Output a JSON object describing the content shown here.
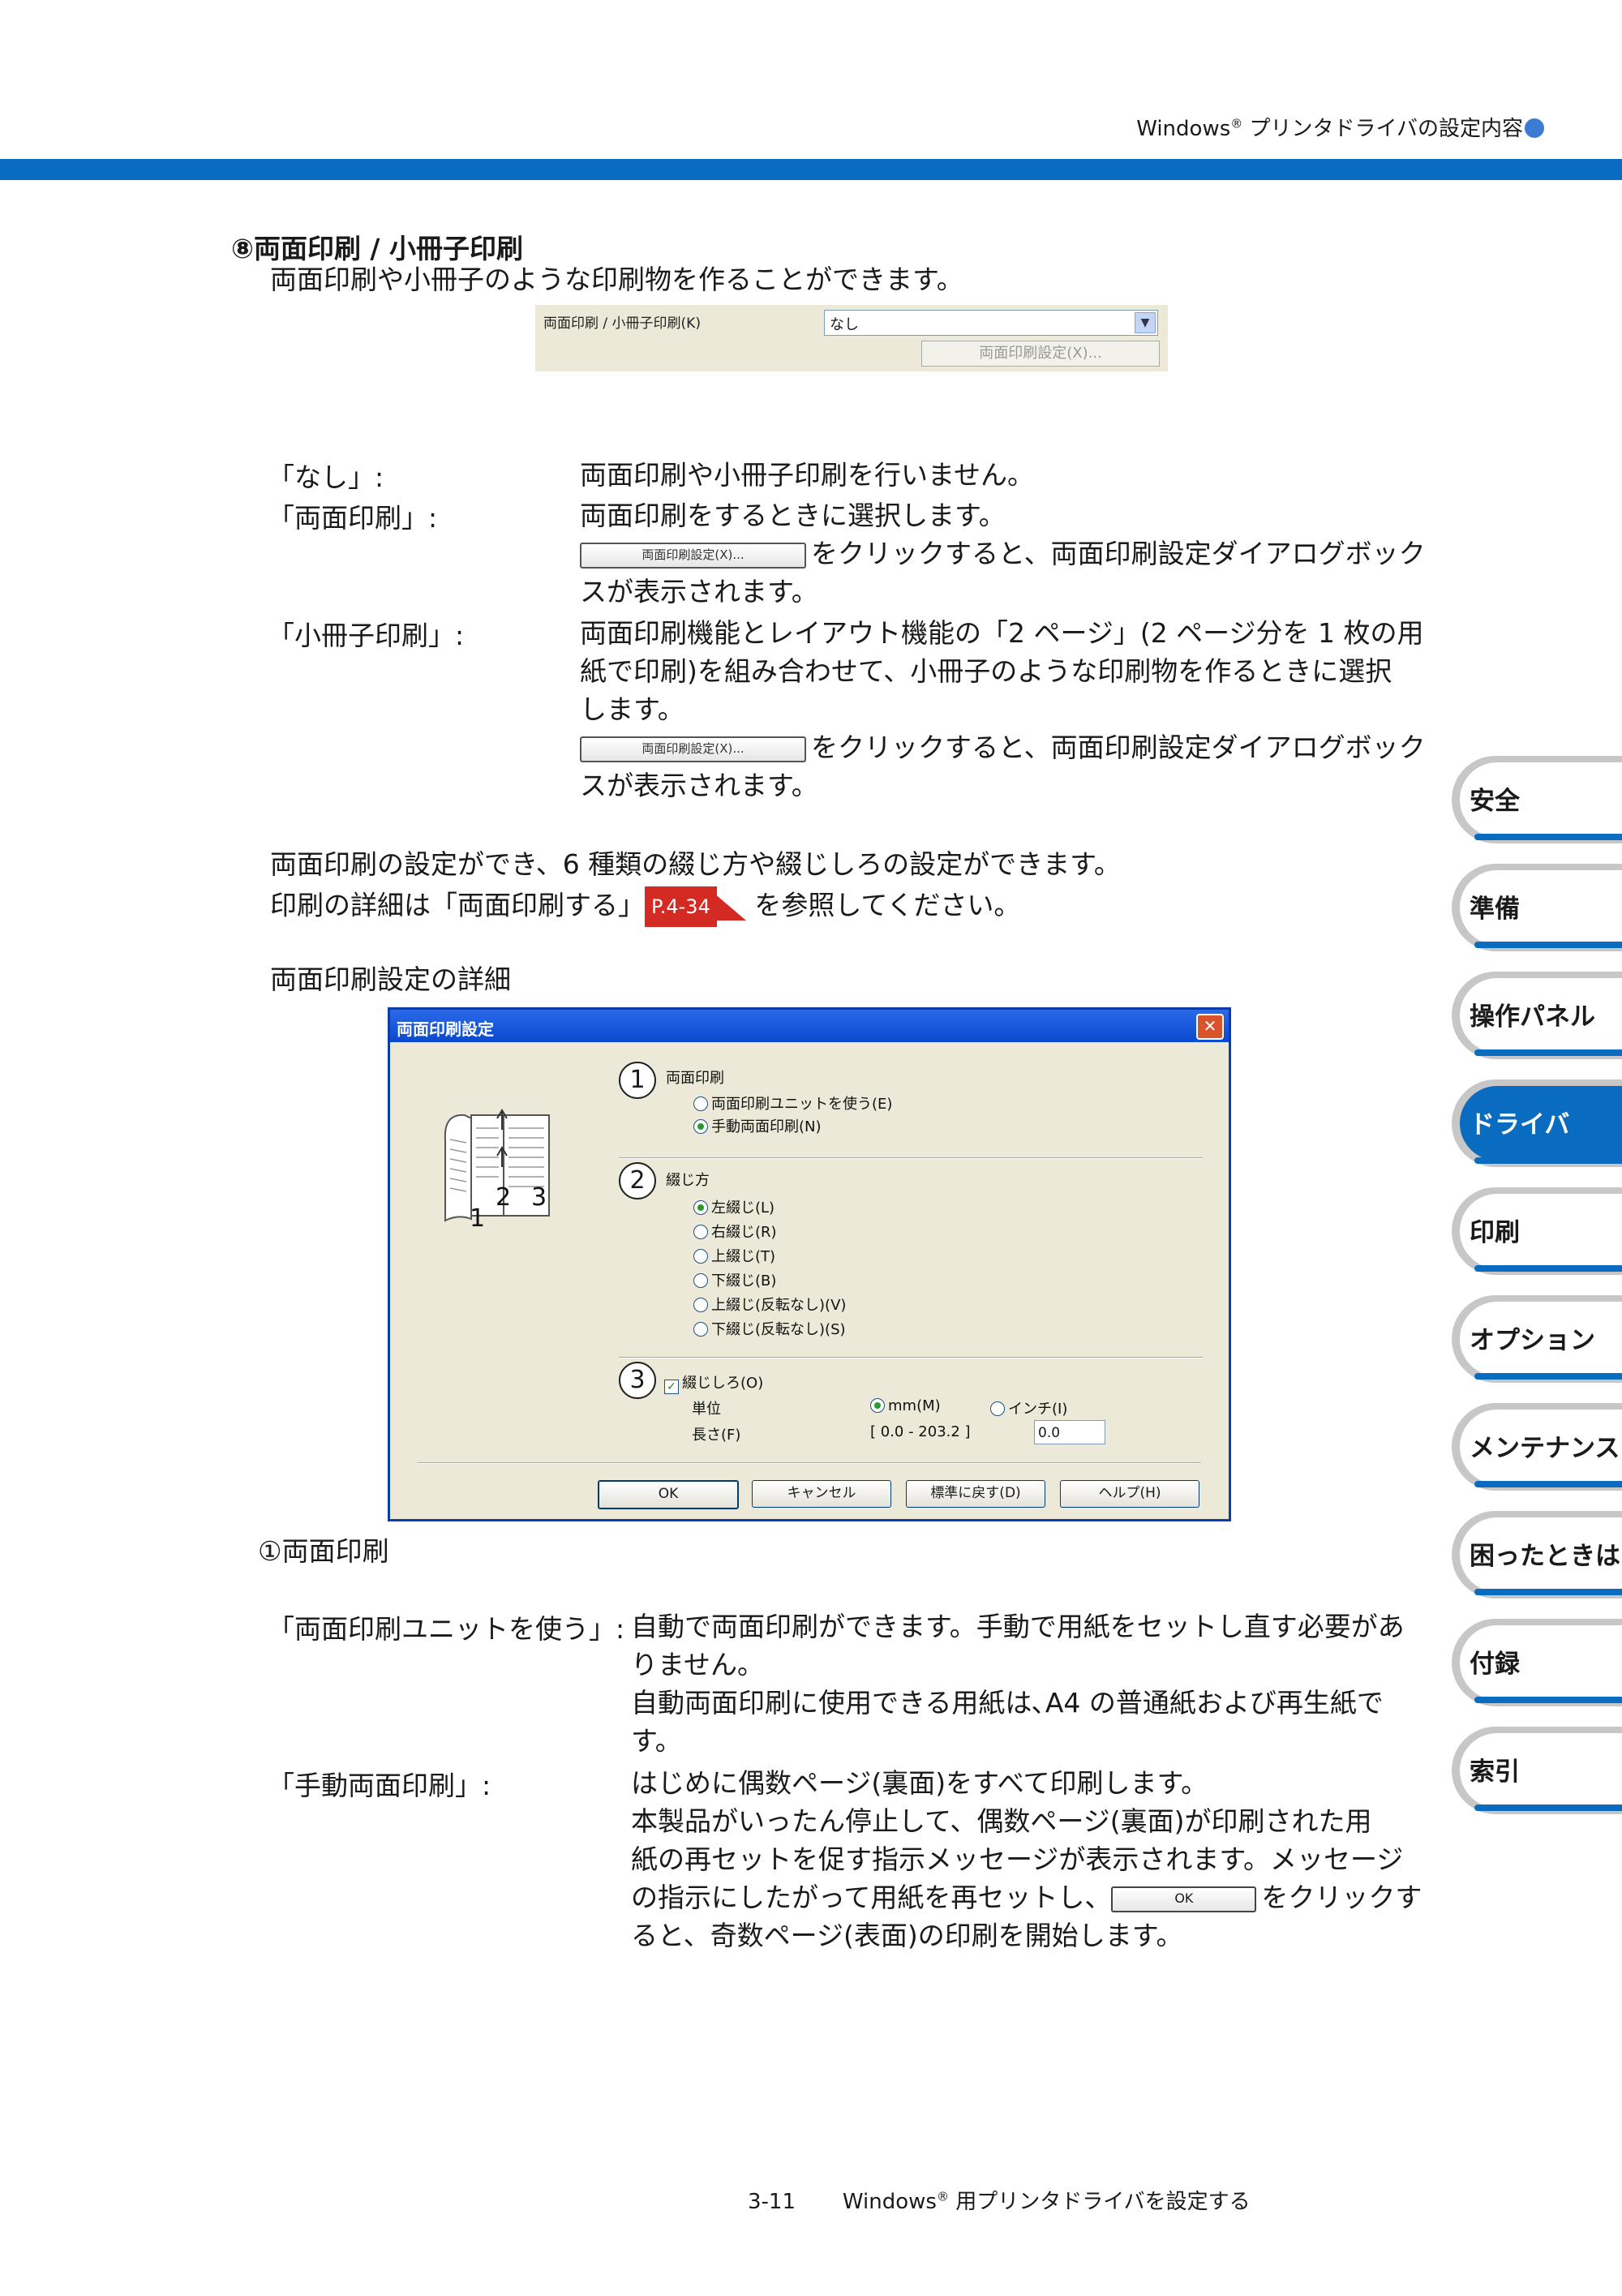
{
  "header": {
    "title": "Windows",
    "title_sup": "®",
    "title_rest": " プリンタドライバの設定内容"
  },
  "section": {
    "heading": "⑧両面印刷 / 小冊子印刷",
    "intro": "両面印刷や小冊子のような印刷物を作ることができます。"
  },
  "snippet": {
    "label": "両面印刷 / 小冊子印刷(K)",
    "select_value": "なし",
    "button": "両面印刷設定(X)..."
  },
  "options": [
    {
      "term": "「なし」:",
      "lines": [
        "両面印刷や小冊子印刷を行いません。"
      ]
    },
    {
      "term": "「両面印刷」:",
      "lines": [
        "両面印刷をするときに選択します。"
      ],
      "btn": "両面印刷設定(X)...",
      "btn_text": "をクリックすると、両面印刷設定ダイアログボック",
      "btn_text2": "スが表示されます。"
    },
    {
      "term": "「小冊子印刷」:",
      "lines": [
        "両面印刷機能とレイアウト機能の「2 ページ」(2 ページ分を 1 枚の用",
        "紙で印刷)を組み合わせて、小冊子のような印刷物を作るときに選択",
        "します。"
      ],
      "btn": "両面印刷設定(X)...",
      "btn_text": "をクリックすると、両面印刷設定ダイアログボック",
      "btn_text2": "スが表示されます。"
    }
  ],
  "para1": "両面印刷の設定ができ、6 種類の綴じ方や綴じしろの設定ができます。",
  "para2_a": "印刷の詳細は「両面印刷する」",
  "para2_ref": "P.4-34",
  "para2_b": "を参照してください。",
  "detail_heading": "両面印刷設定の詳細",
  "dialog": {
    "title": "両面印刷設定",
    "close": "✕",
    "num1": "1",
    "num2": "2",
    "num3": "3",
    "group1": "両面印刷",
    "g1_opts": [
      "両面印刷ユニットを使う(E)",
      "手動両面印刷(N)"
    ],
    "group2": "綴じ方",
    "g2_opts": [
      "左綴じ(L)",
      "右綴じ(R)",
      "上綴じ(T)",
      "下綴じ(B)",
      "上綴じ(反転なし)(V)",
      "下綴じ(反転なし)(S)"
    ],
    "group3": "綴じしろ(O)",
    "unit_label": "単位",
    "unit_mm": "mm(M)",
    "unit_inch": "インチ(I)",
    "length_label": "長さ(F)",
    "range": "[ 0.0 - 203.2 ]",
    "length_value": "0.0",
    "illus": {
      "p1": "1",
      "p2": "2",
      "p3": "3"
    },
    "buttons": [
      "OK",
      "キャンセル",
      "標準に戻す(D)",
      "ヘルプ(H)"
    ]
  },
  "sub_heading": "①両面印刷",
  "unit_option": {
    "term": "「両面印刷ユニットを使う」:",
    "lines": [
      "自動で両面印刷ができます。手動で用紙をセットし直す必要があ",
      "りません。",
      "自動両面印刷に使用できる用紙は､A4 の普通紙および再生紙です。"
    ]
  },
  "manual_option": {
    "term": "「手動両面印刷」:",
    "lines": [
      "はじめに偶数ページ(裏面)をすべて印刷します。",
      "本製品がいったん停止して、偶数ページ(裏面)が印刷された用",
      "紙の再セットを促す指示メッセージが表示されます。メッセージ"
    ],
    "line4_a": "の指示にしたがって用紙を再セットし、",
    "line4_btn": "OK",
    "line4_b": "をクリックす",
    "line5": "ると、奇数ページ(表面)の印刷を開始します。"
  },
  "tabs": [
    {
      "label": "安全",
      "active": false
    },
    {
      "label": "準備",
      "active": false
    },
    {
      "label": "操作パネル",
      "active": false
    },
    {
      "label": "ドライバ",
      "active": true
    },
    {
      "label": "印刷",
      "active": false
    },
    {
      "label": "オプション",
      "active": false
    },
    {
      "label": "メンテナンス",
      "active": false
    },
    {
      "label": "困ったときは",
      "active": false
    },
    {
      "label": "付録",
      "active": false
    },
    {
      "label": "索引",
      "active": false
    }
  ],
  "footer": {
    "page": "3-11",
    "text_a": "Windows",
    "sup": "®",
    "text_b": " 用プリンタドライバを設定する"
  },
  "colors": {
    "accent": "#0a6cc0",
    "ref": "#d42a24"
  }
}
